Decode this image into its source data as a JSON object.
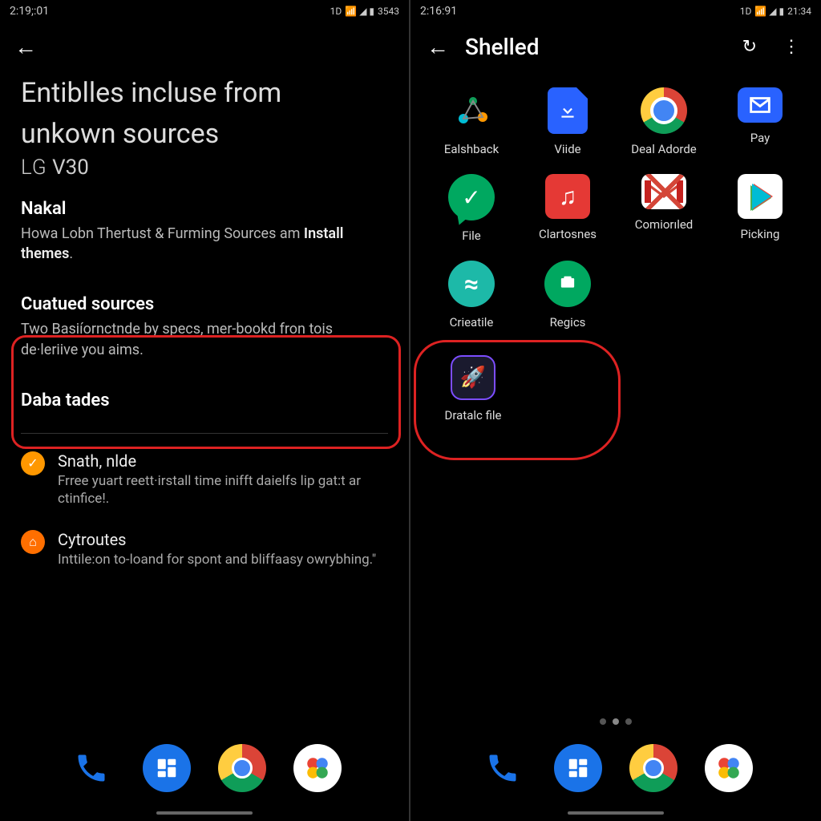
{
  "left": {
    "status": {
      "time": "2:19;:01",
      "right_text": "3543",
      "indicator": "1D"
    },
    "title_line1": "Entiblles incluse from",
    "title_line2": "unkown sources",
    "subtitle_brand": "LG",
    "subtitle_model": "V30",
    "section1": {
      "title": "Nakal",
      "desc_pre": "Howa Lobn Thertust & Furming Sources am ",
      "desc_bold": "Install themes",
      "desc_post": "."
    },
    "section2": {
      "title": "Cuatued sources",
      "desc": "Two Basiíornctnde by specs, mer-bookd fron tois de·leriive you aims."
    },
    "section3": {
      "title": "Daba tades"
    },
    "items": [
      {
        "title": "Snath, nlde",
        "desc": "Frree yuart reett·irstall time inifft daielfs lip gat:t ar ctinfice!."
      },
      {
        "title": "Cytroutes",
        "desc": "Inttile:on to-loand for spont and bliffaasy owrybhing.\""
      }
    ]
  },
  "right": {
    "status": {
      "time": "2:16:91",
      "right_text": "21:34",
      "indicator": "1D"
    },
    "title": "Shelled",
    "apps": [
      {
        "name": "Ealshback",
        "icon": "share"
      },
      {
        "name": "Viide",
        "icon": "file-dl"
      },
      {
        "name": "Deal Adorde",
        "icon": "chrome"
      },
      {
        "name": "Pay",
        "icon": "mail"
      },
      {
        "name": "File",
        "icon": "check"
      },
      {
        "name": "Clartosnes",
        "icon": "music"
      },
      {
        "name": "Comiorıled",
        "icon": "gmail"
      },
      {
        "name": "Picking",
        "icon": "play"
      },
      {
        "name": "Crieatile",
        "icon": "spotify"
      },
      {
        "name": "Regics",
        "icon": "chat"
      }
    ],
    "extra_app": {
      "name": "Dratalc file",
      "icon": "rocket"
    }
  },
  "dock": [
    "phone",
    "apps",
    "chrome",
    "multi"
  ]
}
